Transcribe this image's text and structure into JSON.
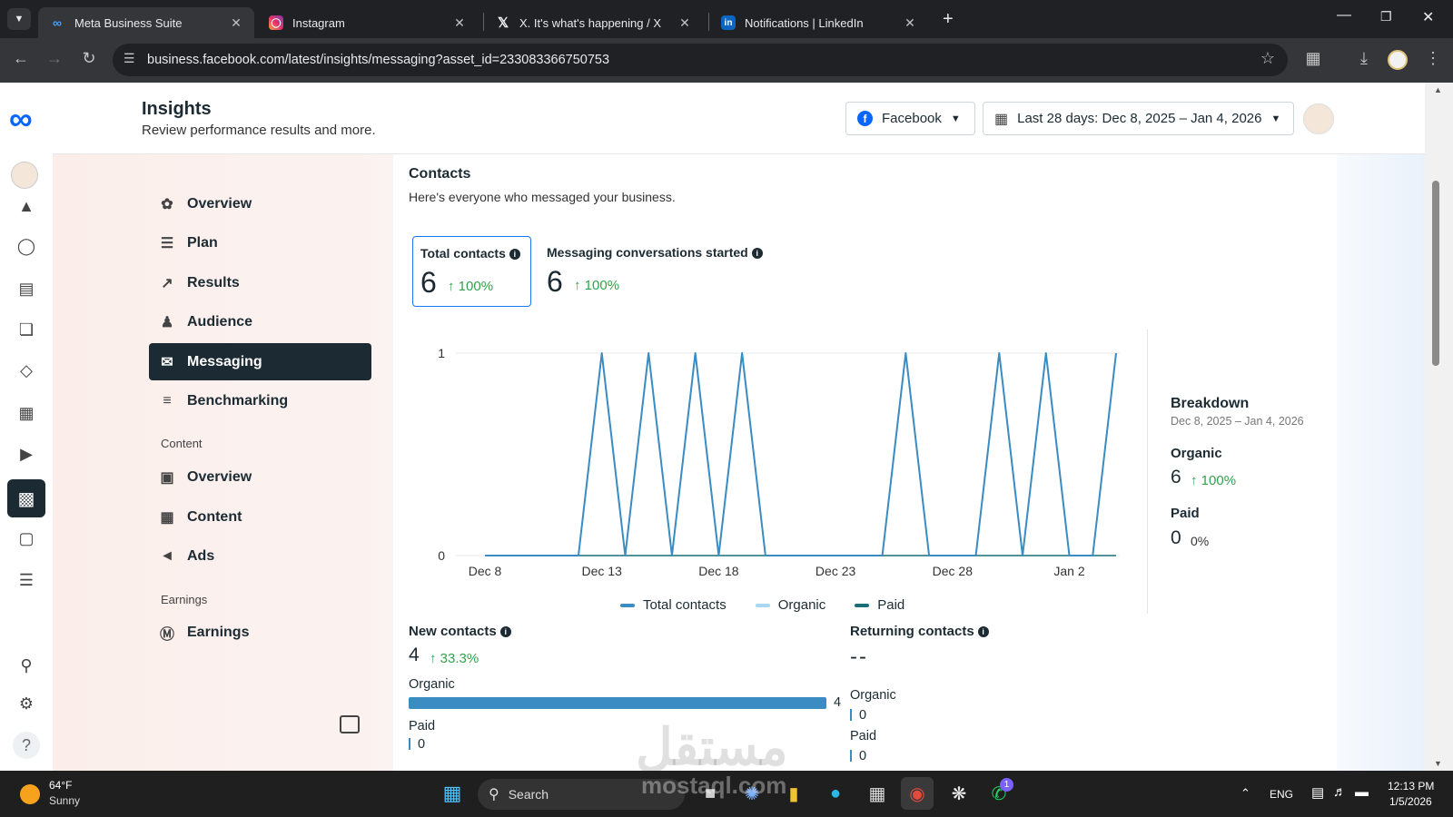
{
  "browser": {
    "tabs": [
      {
        "title": "Meta Business Suite",
        "active": true,
        "icon": "meta-icon"
      },
      {
        "title": "Instagram",
        "active": false,
        "icon": "instagram-icon"
      },
      {
        "title": "X. It's what's happening / X",
        "active": false,
        "icon": "x-icon"
      },
      {
        "title": "Notifications | LinkedIn",
        "active": false,
        "icon": "linkedin-icon"
      }
    ],
    "url": "business.facebook.com/latest/insights/messaging?asset_id=233083366750753"
  },
  "header": {
    "title": "Insights",
    "subtitle": "Review performance results and more.",
    "platform": "Facebook",
    "date_range": "Last 28 days: Dec 8, 2025 – Jan 4, 2026"
  },
  "nav": {
    "items": [
      {
        "label": "Overview",
        "icon": "network-icon"
      },
      {
        "label": "Plan",
        "icon": "list-icon"
      },
      {
        "label": "Results",
        "icon": "trend-icon"
      },
      {
        "label": "Audience",
        "icon": "people-icon"
      },
      {
        "label": "Messaging",
        "icon": "chat-icon",
        "selected": true
      },
      {
        "label": "Benchmarking",
        "icon": "benchmark-icon"
      }
    ],
    "content_heading": "Content",
    "content_items": [
      {
        "label": "Overview",
        "icon": "content-overview-icon"
      },
      {
        "label": "Content",
        "icon": "table-icon"
      },
      {
        "label": "Ads",
        "icon": "megaphone-icon"
      }
    ],
    "earnings_heading": "Earnings",
    "earnings_items": [
      {
        "label": "Earnings",
        "icon": "dollar-icon"
      }
    ]
  },
  "contacts": {
    "title": "Contacts",
    "subtitle": "Here's everyone who messaged your business.",
    "total_label": "Total contacts",
    "total_value": "6",
    "total_change": "100%",
    "conv_label": "Messaging conversations started",
    "conv_value": "6",
    "conv_change": "100%"
  },
  "breakdown": {
    "title": "Breakdown",
    "range": "Dec 8, 2025 – Jan 4, 2026",
    "organic_label": "Organic",
    "organic_value": "6",
    "organic_change": "100%",
    "paid_label": "Paid",
    "paid_value": "0",
    "paid_change": "0%"
  },
  "new_contacts": {
    "title": "New contacts",
    "value": "4",
    "change": "33.3%",
    "organic_label": "Organic",
    "organic_value": "4",
    "organic_fraction": 1.0,
    "paid_label": "Paid",
    "paid_value": "0"
  },
  "returning_contacts": {
    "title": "Returning contacts",
    "value": "--",
    "organic_label": "Organic",
    "organic_value": "0",
    "paid_label": "Paid",
    "paid_value": "0"
  },
  "taskbar": {
    "weather_temp": "64°F",
    "weather_desc": "Sunny",
    "search": "Search",
    "lang": "ENG",
    "time": "12:13 PM",
    "date": "1/5/2026",
    "whatsapp_badge": "1"
  },
  "watermark": "مستقل",
  "watermark_sub": "mostaql.com",
  "colors": {
    "total": "#3a8cc2",
    "organic": "#a9d6f0",
    "paid": "#1a6e7a",
    "accent": "#1c2b33"
  },
  "chart_data": {
    "type": "line",
    "x": [
      "Dec 8",
      "Dec 9",
      "Dec 10",
      "Dec 11",
      "Dec 12",
      "Dec 13",
      "Dec 14",
      "Dec 15",
      "Dec 16",
      "Dec 17",
      "Dec 18",
      "Dec 19",
      "Dec 20",
      "Dec 21",
      "Dec 22",
      "Dec 23",
      "Dec 24",
      "Dec 25",
      "Dec 26",
      "Dec 27",
      "Dec 28",
      "Dec 29",
      "Dec 30",
      "Dec 31",
      "Jan 1",
      "Jan 2",
      "Jan 3",
      "Jan 4"
    ],
    "xticks": [
      "Dec 8",
      "Dec 13",
      "Dec 18",
      "Dec 23",
      "Dec 28",
      "Jan 2"
    ],
    "yticks": [
      0,
      1
    ],
    "ylim": [
      0,
      1
    ],
    "series": [
      {
        "name": "Total contacts",
        "values": [
          0,
          0,
          0,
          0,
          0,
          1,
          0,
          1,
          0,
          1,
          0,
          1,
          0,
          0,
          0,
          0,
          0,
          0,
          1,
          0,
          0,
          0,
          1,
          0,
          1,
          0,
          0,
          1
        ]
      },
      {
        "name": "Organic",
        "values": [
          0,
          0,
          0,
          0,
          0,
          1,
          0,
          1,
          0,
          1,
          0,
          1,
          0,
          0,
          0,
          0,
          0,
          0,
          1,
          0,
          0,
          0,
          1,
          0,
          1,
          0,
          0,
          1
        ]
      },
      {
        "name": "Paid",
        "values": [
          0,
          0,
          0,
          0,
          0,
          0,
          0,
          0,
          0,
          0,
          0,
          0,
          0,
          0,
          0,
          0,
          0,
          0,
          0,
          0,
          0,
          0,
          0,
          0,
          0,
          0,
          0,
          0
        ]
      }
    ],
    "legend": "bottom"
  }
}
